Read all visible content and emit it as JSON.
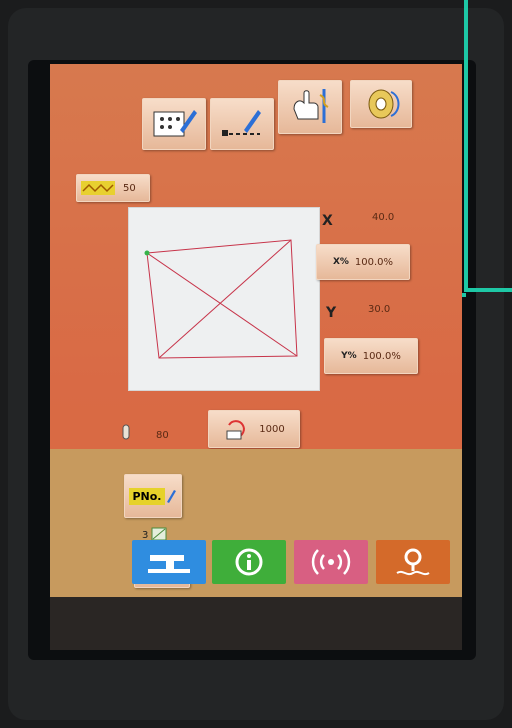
{
  "window": {
    "title": ""
  },
  "top_toolbar": {
    "items": [
      {
        "name": "program-edit-icon"
      },
      {
        "name": "line-edit-icon"
      },
      {
        "name": "manual-needle-icon"
      },
      {
        "name": "bobbin-winder-icon"
      }
    ]
  },
  "stitch": {
    "label": "50",
    "icon": "stitch-length-icon"
  },
  "dimensions": {
    "x_label": "X",
    "x_value": "40.0",
    "x_scale_value": "100.0%",
    "x_scale_icon_text": "X%",
    "y_label": "Y",
    "y_value": "30.0",
    "y_scale_value": "100.0%",
    "y_scale_icon_text": "Y%"
  },
  "tension": {
    "value": "80"
  },
  "counter": {
    "value": "1000"
  },
  "program": {
    "button_text": "PNo.",
    "number": "3"
  },
  "footer": {
    "buttons": [
      {
        "name": "sewing-mode-button",
        "color": "#2f8de0"
      },
      {
        "name": "info-button",
        "color": "#3fae3a"
      },
      {
        "name": "communication-button",
        "color": "#d85f82"
      },
      {
        "name": "search-button",
        "color": "#d46a2a"
      }
    ]
  },
  "colors": {
    "accent_bracket": "#1ec8a6",
    "screen_orange": "#d96a45",
    "pattern_lines": "#c7344a"
  }
}
